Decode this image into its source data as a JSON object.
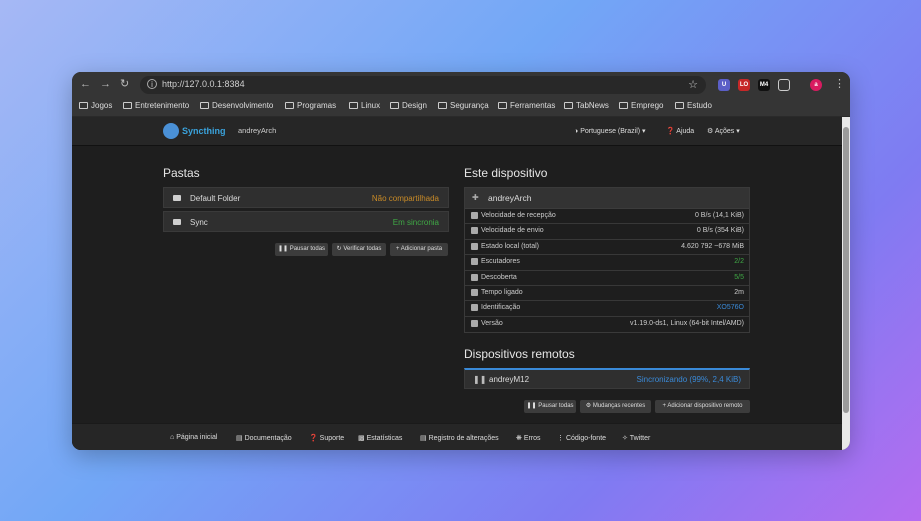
{
  "browser": {
    "url": "http://127.0.0.1:8384",
    "profile_initial": "a",
    "bookmarks": [
      "Jogos",
      "Entretenimento",
      "Desenvolvimento",
      "Programas",
      "Linux",
      "Design",
      "Segurança",
      "Ferramentas",
      "TabNews",
      "Emprego",
      "Estudo"
    ],
    "extensions": [
      "U",
      "LO",
      "M4",
      ""
    ]
  },
  "app": {
    "brand": "Syncthing",
    "device_name": "andreyArch",
    "language": "Portuguese (Brazil)",
    "help": "Ajuda",
    "actions": "Ações"
  },
  "folders": {
    "title": "Pastas",
    "items": [
      {
        "name": "Default Folder",
        "status": "Não compartilhada",
        "status_color": "#c98b27"
      },
      {
        "name": "Sync",
        "status": "Em sincronia",
        "status_color": "#3fa845"
      }
    ],
    "buttons": [
      "Pausar todas",
      "Verificar todas",
      "Adicionar pasta"
    ]
  },
  "this_device": {
    "title": "Este dispositivo",
    "name": "andreyArch",
    "rows": [
      {
        "label": "Velocidade de recepção",
        "value": "0 B/s (14,1 KiB)",
        "color": "#cccccc"
      },
      {
        "label": "Velocidade de envio",
        "value": "0 B/s (354 KiB)",
        "color": "#cccccc"
      },
      {
        "label": "Estado local (total)",
        "value": "4.620   792   ~678 MiB",
        "color": "#cccccc"
      },
      {
        "label": "Escutadores",
        "value": "2/2",
        "color": "#3fa845"
      },
      {
        "label": "Descoberta",
        "value": "5/5",
        "color": "#3fa845"
      },
      {
        "label": "Tempo ligado",
        "value": "2m",
        "color": "#cccccc"
      },
      {
        "label": "Identificação",
        "value": "XO576O",
        "color": "#3a8ad8"
      },
      {
        "label": "Versão",
        "value": "v1.19.0-ds1, Linux (64-bit Intel/AMD)",
        "color": "#cccccc"
      }
    ]
  },
  "remote_devices": {
    "title": "Dispositivos remotos",
    "items": [
      {
        "name": "andreyM12",
        "status": "Sincronizando (99%, 2,4 KiB)",
        "status_color": "#3a8ad8",
        "progress": 0.99
      }
    ],
    "buttons": [
      "Pausar todas",
      "Mudanças recentes",
      "Adicionar dispositivo remoto"
    ]
  },
  "footer": [
    "Página inicial",
    "Documentação",
    "Suporte",
    "Estatísticas",
    "Registro de alterações",
    "Erros",
    "Código-fonte",
    "Twitter"
  ]
}
